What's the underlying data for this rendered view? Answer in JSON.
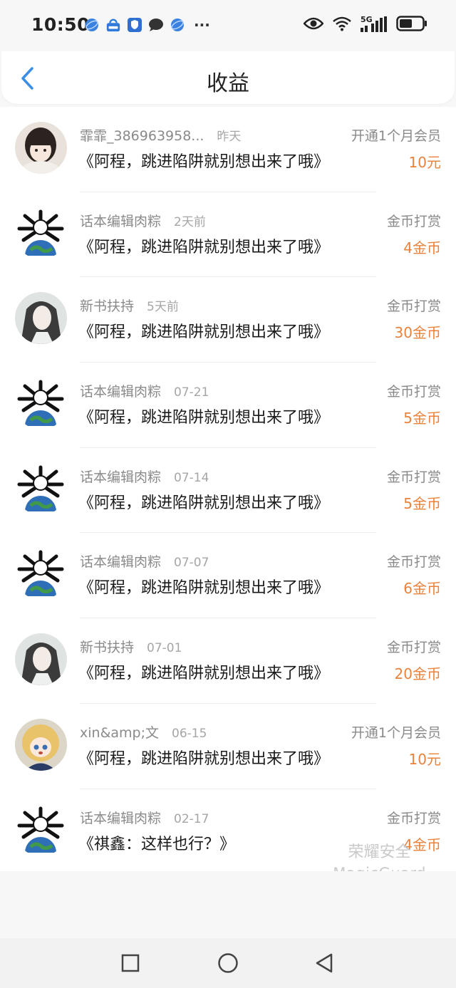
{
  "status_bar": {
    "time": "10:50",
    "notification_icons": [
      "browser-icon",
      "cloud-backup-icon",
      "security-icon",
      "chat-icon",
      "browser-icon"
    ],
    "more": "···",
    "network": "5G"
  },
  "header": {
    "title": "收益"
  },
  "rows": [
    {
      "user": "霏霏_386963958...",
      "time": "昨天",
      "title": "《阿程，跳进陷阱就别想出来了哦》",
      "type": "开通1个月会员",
      "amount": "10元",
      "avatar": "girl-photo"
    },
    {
      "user": "话本编辑肉粽",
      "time": "2天前",
      "title": "《阿程，跳进陷阱就别想出来了哦》",
      "type": "金币打赏",
      "amount": "4金币",
      "avatar": "earth-meme"
    },
    {
      "user": "新书扶持",
      "time": "5天前",
      "title": "《阿程，跳进陷阱就别想出来了哦》",
      "type": "金币打赏",
      "amount": "30金币",
      "avatar": "anime-portrait"
    },
    {
      "user": "话本编辑肉粽",
      "time": "07-21",
      "title": "《阿程，跳进陷阱就别想出来了哦》",
      "type": "金币打赏",
      "amount": "5金币",
      "avatar": "earth-meme"
    },
    {
      "user": "话本编辑肉粽",
      "time": "07-14",
      "title": "《阿程，跳进陷阱就别想出来了哦》",
      "type": "金币打赏",
      "amount": "5金币",
      "avatar": "earth-meme"
    },
    {
      "user": "话本编辑肉粽",
      "time": "07-07",
      "title": "《阿程，跳进陷阱就别想出来了哦》",
      "type": "金币打赏",
      "amount": "6金币",
      "avatar": "earth-meme"
    },
    {
      "user": "新书扶持",
      "time": "07-01",
      "title": "《阿程，跳进陷阱就别想出来了哦》",
      "type": "金币打赏",
      "amount": "20金币",
      "avatar": "anime-portrait"
    },
    {
      "user": "xin&amp;文",
      "time": "06-15",
      "title": "《阿程，跳进陷阱就别想出来了哦》",
      "type": "开通1个月会员",
      "amount": "10元",
      "avatar": "anime-girl"
    },
    {
      "user": "话本编辑肉粽",
      "time": "02-17",
      "title": "《祺鑫：这样也行？》",
      "type": "金币打赏",
      "amount": "4金币",
      "avatar": "earth-meme"
    }
  ],
  "watermark": {
    "line1": "荣耀安全",
    "line2": "MagicGuard"
  },
  "colors": {
    "accent_blue": "#3a8ee6",
    "amount_orange": "#e8823d"
  }
}
